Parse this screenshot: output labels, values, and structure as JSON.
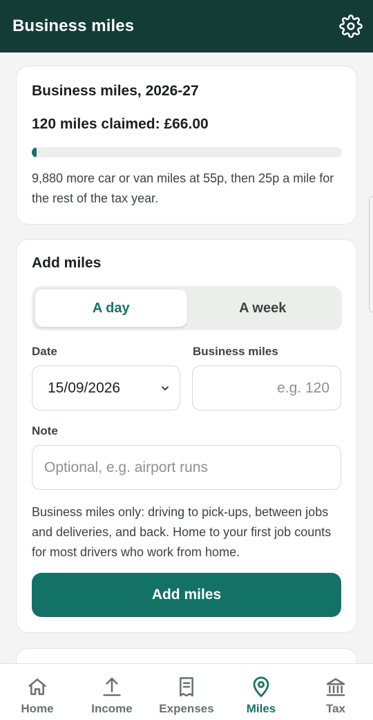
{
  "app_bar": {
    "title": "Business miles",
    "settings_icon": "gear-icon"
  },
  "summary": {
    "title": "Business miles, 2026-27",
    "claimed": "120 miles claimed: £66.00",
    "progress_fraction": 0.012,
    "note": "9,880 more car or van miles at 55p, then 25p a mile for the rest of the tax year."
  },
  "add_miles": {
    "title": "Add miles",
    "segments": [
      {
        "label": "A day",
        "active": true
      },
      {
        "label": "A week",
        "active": false
      }
    ],
    "date_label": "Date",
    "date_value": "15/09/2026",
    "miles_label": "Business miles",
    "miles_placeholder": "e.g. 120",
    "note_label": "Note",
    "note_placeholder": "Optional, e.g. airport runs",
    "help": "Business miles only: driving to pick-ups, between jobs and deliveries, and back. Home to your first job counts for most drivers who work from home.",
    "button_label": "Add miles"
  },
  "nav": {
    "items": [
      {
        "label": "Home",
        "icon": "home-icon",
        "active": false
      },
      {
        "label": "Income",
        "icon": "upload-arrow-icon",
        "active": false
      },
      {
        "label": "Expenses",
        "icon": "receipt-icon",
        "active": false
      },
      {
        "label": "Miles",
        "icon": "location-pin-icon",
        "active": true
      },
      {
        "label": "Tax",
        "icon": "bank-icon",
        "active": false
      }
    ]
  },
  "colors": {
    "app_bar": "#143c36",
    "accent": "#167466",
    "background": "#f3f4f3"
  }
}
